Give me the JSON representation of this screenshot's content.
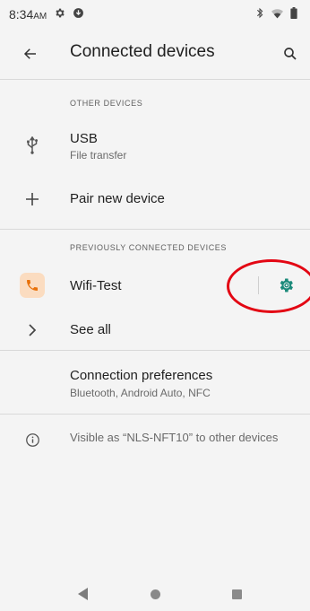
{
  "status_bar": {
    "time": "8:34",
    "meridiem": "AM",
    "icons": [
      "settings-gear-icon",
      "download-circle-icon",
      "bluetooth-icon",
      "wifi-icon",
      "battery-icon"
    ]
  },
  "app_bar": {
    "title": "Connected devices",
    "back_icon": "arrow-back-icon",
    "search_icon": "search-icon"
  },
  "other_devices": {
    "header": "OTHER DEVICES",
    "usb": {
      "title": "USB",
      "subtitle": "File transfer",
      "icon": "usb-icon"
    },
    "pair": {
      "title": "Pair new device",
      "icon": "plus-icon"
    }
  },
  "previously_connected": {
    "header": "PREVIOUSLY CONNECTED DEVICES",
    "device": {
      "title": "Wifi-Test",
      "icon": "phone-icon",
      "settings_icon": "gear-icon"
    },
    "see_all": {
      "title": "See all",
      "icon": "chevron-right-icon"
    }
  },
  "connection_preferences": {
    "title": "Connection preferences",
    "subtitle": "Bluetooth, Android Auto, NFC"
  },
  "visibility_info": {
    "text": "Visible as “NLS-NFT10” to other devices",
    "icon": "info-icon"
  },
  "navigation": {
    "icons": [
      "nav-back-icon",
      "nav-home-icon",
      "nav-recents-icon"
    ]
  },
  "colors": {
    "accent": "#1b8a7a",
    "highlight": "#e30613",
    "phone_badge_bg": "#fbdcc0",
    "phone_icon": "#e8710a"
  }
}
